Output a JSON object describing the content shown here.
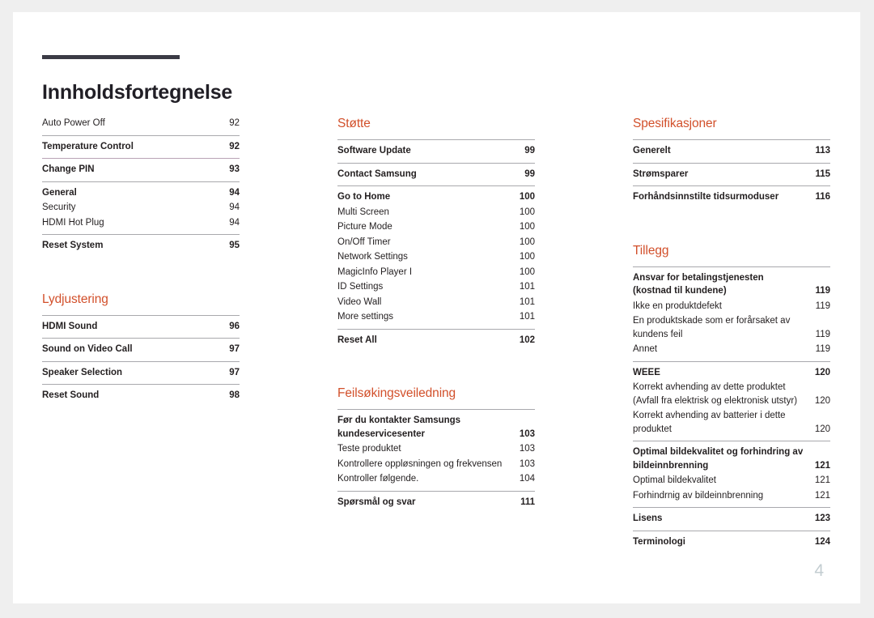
{
  "document": {
    "title": "Innholdsfortegnelse",
    "folio": "4",
    "accent_color": "#d2502b",
    "rule_color": "#3b3b45"
  },
  "columns": [
    {
      "name": "column-left",
      "sections": [
        {
          "heading": null,
          "groups": [
            {
              "rule": "none",
              "entries": [
                {
                  "label": "Auto Power Off",
                  "page": "92",
                  "bold": false
                }
              ]
            },
            {
              "rule": "gray",
              "entries": [
                {
                  "label": "Temperature Control",
                  "page": "92",
                  "bold": true
                }
              ]
            },
            {
              "rule": "mauve",
              "entries": [
                {
                  "label": "Change PIN",
                  "page": "93",
                  "bold": true
                }
              ]
            },
            {
              "rule": "gray",
              "entries": [
                {
                  "label": "General",
                  "page": "94",
                  "bold": true
                },
                {
                  "label": "Security",
                  "page": "94",
                  "bold": false
                },
                {
                  "label": "HDMI Hot Plug",
                  "page": "94",
                  "bold": false
                }
              ]
            },
            {
              "rule": "gray",
              "entries": [
                {
                  "label": "Reset System",
                  "page": "95",
                  "bold": true
                }
              ]
            }
          ]
        },
        {
          "heading": "Lydjustering",
          "groups": [
            {
              "rule": "gray",
              "entries": [
                {
                  "label": "HDMI Sound",
                  "page": "96",
                  "bold": true
                }
              ]
            },
            {
              "rule": "gray",
              "entries": [
                {
                  "label": "Sound on Video Call",
                  "page": "97",
                  "bold": true
                }
              ]
            },
            {
              "rule": "gray",
              "entries": [
                {
                  "label": "Speaker Selection",
                  "page": "97",
                  "bold": true
                }
              ]
            },
            {
              "rule": "gray",
              "entries": [
                {
                  "label": "Reset Sound",
                  "page": "98",
                  "bold": true
                }
              ]
            }
          ]
        }
      ]
    },
    {
      "name": "column-middle",
      "sections": [
        {
          "heading": "Støtte",
          "groups": [
            {
              "rule": "gray",
              "entries": [
                {
                  "label": "Software Update",
                  "page": "99",
                  "bold": true
                }
              ]
            },
            {
              "rule": "gray",
              "entries": [
                {
                  "label": "Contact Samsung",
                  "page": "99",
                  "bold": true
                }
              ]
            },
            {
              "rule": "gray",
              "entries": [
                {
                  "label": "Go to Home",
                  "page": "100",
                  "bold": true
                },
                {
                  "label": "Multi Screen",
                  "page": "100",
                  "bold": false
                },
                {
                  "label": "Picture Mode",
                  "page": "100",
                  "bold": false
                },
                {
                  "label": "On/Off Timer",
                  "page": "100",
                  "bold": false
                },
                {
                  "label": "Network Settings",
                  "page": "100",
                  "bold": false
                },
                {
                  "label": "MagicInfo Player I",
                  "page": "100",
                  "bold": false
                },
                {
                  "label": "ID Settings",
                  "page": "101",
                  "bold": false
                },
                {
                  "label": "Video Wall",
                  "page": "101",
                  "bold": false
                },
                {
                  "label": "More settings",
                  "page": "101",
                  "bold": false
                }
              ]
            },
            {
              "rule": "gray",
              "entries": [
                {
                  "label": "Reset All",
                  "page": "102",
                  "bold": true
                }
              ]
            }
          ]
        },
        {
          "heading": "Feilsøkingsveiledning",
          "groups": [
            {
              "rule": "gray",
              "entries": [
                {
                  "label": "Før du kontakter Samsungs kundeservicesenter",
                  "lines": [
                    "Før du kontakter Samsungs",
                    "kundeservicesenter"
                  ],
                  "page": "103",
                  "bold": true
                },
                {
                  "label": "Teste produktet",
                  "page": "103",
                  "bold": false
                },
                {
                  "label": "Kontrollere oppløsningen og frekvensen",
                  "page": "103",
                  "bold": false
                },
                {
                  "label": "Kontroller følgende.",
                  "page": "104",
                  "bold": false
                }
              ]
            },
            {
              "rule": "gray",
              "entries": [
                {
                  "label": "Spørsmål og svar",
                  "page": "111",
                  "bold": true
                }
              ]
            }
          ]
        }
      ]
    },
    {
      "name": "column-right",
      "sections": [
        {
          "heading": "Spesifikasjoner",
          "groups": [
            {
              "rule": "gray",
              "entries": [
                {
                  "label": "Generelt",
                  "page": "113",
                  "bold": true
                }
              ]
            },
            {
              "rule": "gray",
              "entries": [
                {
                  "label": "Strømsparer",
                  "page": "115",
                  "bold": true
                }
              ]
            },
            {
              "rule": "gray",
              "entries": [
                {
                  "label": "Forhåndsinnstilte tidsurmoduser",
                  "page": "116",
                  "bold": true
                }
              ]
            }
          ]
        },
        {
          "heading": "Tillegg",
          "groups": [
            {
              "rule": "gray",
              "entries": [
                {
                  "label": "Ansvar for betalingstjenesten (kostnad til kundene)",
                  "lines": [
                    "Ansvar for betalingstjenesten",
                    "(kostnad til kundene)"
                  ],
                  "page": "119",
                  "bold": true
                },
                {
                  "label": "Ikke en produktdefekt",
                  "page": "119",
                  "bold": false
                },
                {
                  "label": "En produktskade som er forårsaket av kundens feil",
                  "lines": [
                    "En produktskade som er forårsaket av",
                    "kundens feil"
                  ],
                  "page": "119",
                  "bold": false
                },
                {
                  "label": "Annet",
                  "page": "119",
                  "bold": false
                }
              ]
            },
            {
              "rule": "gray",
              "entries": [
                {
                  "label": "WEEE",
                  "page": "120",
                  "bold": true
                },
                {
                  "label": "Korrekt avhending av dette produktet (Avfall fra elektrisk og elektronisk utstyr)",
                  "lines": [
                    "Korrekt avhending av dette produktet",
                    "(Avfall fra elektrisk og elektronisk utstyr)"
                  ],
                  "page": "120",
                  "bold": false
                },
                {
                  "label": "Korrekt avhending av batterier i dette produktet",
                  "lines": [
                    "Korrekt avhending av batterier i dette",
                    "produktet"
                  ],
                  "page": "120",
                  "bold": false
                }
              ]
            },
            {
              "rule": "gray",
              "entries": [
                {
                  "label": "Optimal bildekvalitet og forhindring av bildeinnbrenning",
                  "lines": [
                    "Optimal bildekvalitet og forhindring av",
                    "bildeinnbrenning"
                  ],
                  "page": "121",
                  "bold": true
                },
                {
                  "label": "Optimal bildekvalitet",
                  "page": "121",
                  "bold": false
                },
                {
                  "label": "Forhindrnig av bildeinnbrenning",
                  "page": "121",
                  "bold": false
                }
              ]
            },
            {
              "rule": "gray",
              "entries": [
                {
                  "label": "Lisens",
                  "page": "123",
                  "bold": true
                }
              ]
            },
            {
              "rule": "gray",
              "entries": [
                {
                  "label": "Terminologi",
                  "page": "124",
                  "bold": true
                }
              ]
            }
          ]
        }
      ]
    }
  ]
}
